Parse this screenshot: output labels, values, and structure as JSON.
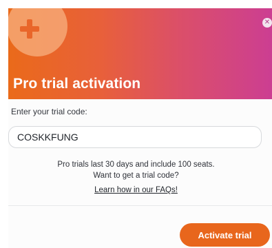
{
  "dialog": {
    "title": "Pro trial activation",
    "close_icon": "close-icon",
    "logo_icon": "plus-icon"
  },
  "form": {
    "label": "Enter your trial code:",
    "code_value": "COSKKFUNG"
  },
  "info": {
    "line1": "Pro trials last 30 days and include 100 seats.",
    "line2": "Want to get a trial code?",
    "faq_link": "Learn how in our FAQs!"
  },
  "actions": {
    "activate_label": "Activate trial"
  },
  "colors": {
    "gradient_start": "#ea6a1a",
    "gradient_end": "#cc3e92",
    "button": "#e8661c"
  }
}
